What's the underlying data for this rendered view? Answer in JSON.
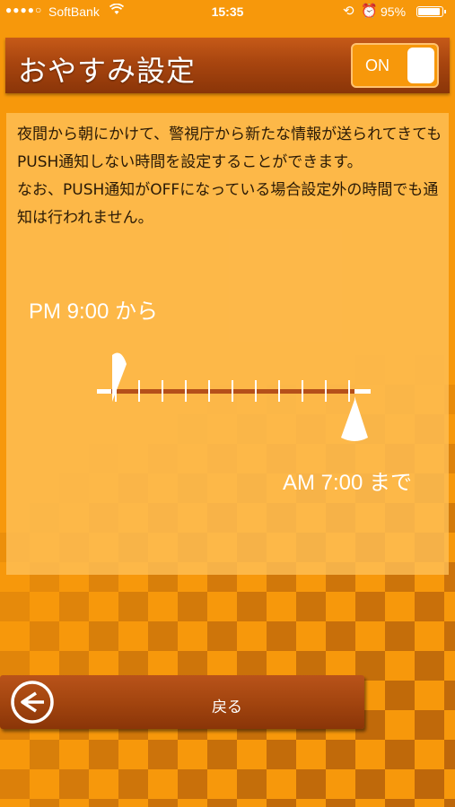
{
  "status_bar": {
    "signal": "●●●●○",
    "carrier": "SoftBank",
    "time": "15:35",
    "battery": "95%",
    "battery_level": 0.95
  },
  "header": {
    "title": "おやすみ設定",
    "toggle_label": "ON",
    "toggle_state": true
  },
  "description": [
    "夜間から朝にかけて、警視庁から新たな情報が送られてきてもPUSH通知しない時間を設定することができます。",
    "なお、PUSH通知がOFFになっている場合設定外の時間でも通知は行われません。"
  ],
  "schedule": {
    "from_label": "PM 9:00 から",
    "to_label": "AM 7:00 まで",
    "tick_count": 11
  },
  "back_button": {
    "label": "戻る"
  },
  "colors": {
    "background": "#f7980b",
    "header": "#a8450f",
    "panel": "#ffc15a",
    "slider_line": "#b5501a"
  },
  "icons": [
    "wifi-icon",
    "lock-rotation-icon",
    "alarm-icon",
    "battery-icon",
    "back-arrow-icon"
  ]
}
